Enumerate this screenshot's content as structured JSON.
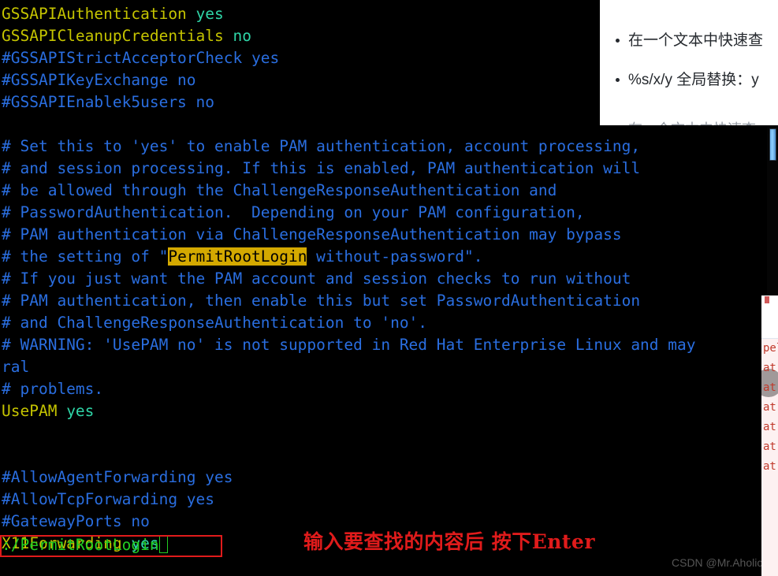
{
  "terminal": {
    "lines": [
      {
        "type": "kv",
        "key": "GSSAPIAuthentication",
        "value": "yes"
      },
      {
        "type": "kv",
        "key": "GSSAPICleanupCredentials",
        "value": "no"
      },
      {
        "type": "comment",
        "text": "#GSSAPIStrictAcceptorCheck yes"
      },
      {
        "type": "comment",
        "text": "#GSSAPIKeyExchange no"
      },
      {
        "type": "comment",
        "text": "#GSSAPIEnablek5users no"
      },
      {
        "type": "blank",
        "text": ""
      },
      {
        "type": "comment",
        "text": "# Set this to 'yes' to enable PAM authentication, account processing,"
      },
      {
        "type": "comment",
        "text": "# and session processing. If this is enabled, PAM authentication will"
      },
      {
        "type": "comment",
        "text": "# be allowed through the ChallengeResponseAuthentication and"
      },
      {
        "type": "comment",
        "text": "# PasswordAuthentication.  Depending on your PAM configuration,"
      },
      {
        "type": "comment",
        "text": "# PAM authentication via ChallengeResponseAuthentication may bypass"
      },
      {
        "type": "match",
        "before": "# the setting of \"",
        "match": "PermitRootLogin",
        "after": " without-password\"."
      },
      {
        "type": "comment",
        "text": "# If you just want the PAM account and session checks to run without"
      },
      {
        "type": "comment",
        "text": "# PAM authentication, then enable this but set PasswordAuthentication"
      },
      {
        "type": "comment",
        "text": "# and ChallengeResponseAuthentication to 'no'."
      },
      {
        "type": "comment",
        "text": "# WARNING: 'UsePAM no' is not supported in Red Hat Enterprise Linux and may"
      },
      {
        "type": "wrap",
        "text": "ral"
      },
      {
        "type": "comment",
        "text": "# problems."
      },
      {
        "type": "kv",
        "key": "UsePAM",
        "value": "yes"
      },
      {
        "type": "blank",
        "text": ""
      },
      {
        "type": "blank",
        "text": ""
      },
      {
        "type": "comment",
        "text": "#AllowAgentForwarding yes"
      },
      {
        "type": "comment",
        "text": "#AllowTcpForwarding yes"
      },
      {
        "type": "comment",
        "text": "#GatewayPorts no"
      },
      {
        "type": "kv",
        "key": "X11Forwarding",
        "value": "yes"
      }
    ],
    "colors": {
      "background": "#000000",
      "key": "#c5c400",
      "value": "#2fd6a8",
      "comment": "#2a6ee0",
      "highlight_bg": "#d4a900",
      "highlight_fg": "#000000",
      "command": "#22cc22"
    }
  },
  "command_line": {
    "text": ":/PermitRootLogin",
    "cursor": "block-cursor"
  },
  "annotation": {
    "text": "输入要查找的内容后 按下Enter",
    "color": "#e01b1b",
    "rect_color": "#e01b1b"
  },
  "watermark": {
    "text": "CSDN @Mr.Aholic"
  },
  "scrollbar": {
    "thumb_color": "#8fd0ff",
    "position_label": "near-top"
  },
  "popup": {
    "bullets": [
      "在一个文本中快速查",
      "%s/x/y 全局替换：y"
    ],
    "faint_line": "在一个文本中快速查"
  },
  "side_panel": {
    "lines": [
      "pel",
      "at",
      "at",
      "at",
      "at",
      "at",
      "at"
    ]
  }
}
